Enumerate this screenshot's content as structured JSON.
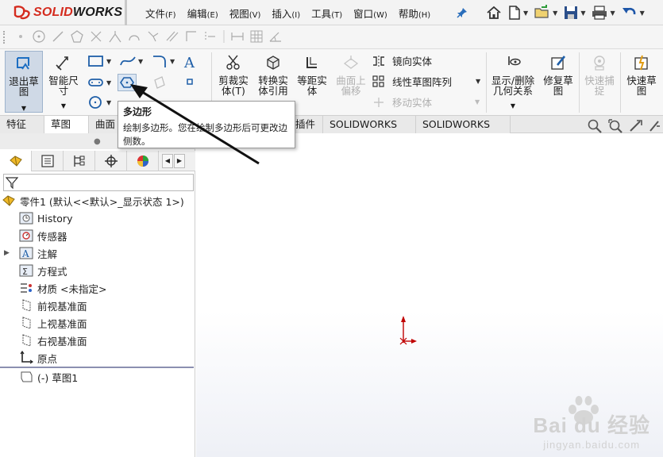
{
  "app": {
    "logo_prefix": "",
    "logo_accent": "SOLID",
    "logo_rest": "WORKS",
    "brand_color": "#d42b1e"
  },
  "menu": [
    {
      "label": "文件",
      "key": "(F)"
    },
    {
      "label": "编辑",
      "key": "(E)"
    },
    {
      "label": "视图",
      "key": "(V)"
    },
    {
      "label": "插入",
      "key": "(I)"
    },
    {
      "label": "工具",
      "key": "(T)"
    },
    {
      "label": "窗口",
      "key": "(W)"
    },
    {
      "label": "帮助",
      "key": "(H)"
    }
  ],
  "quick_access_icons": [
    "home-icon",
    "new-document-icon",
    "open-folder-icon",
    "save-icon",
    "print-icon",
    "undo-icon"
  ],
  "command_manager": {
    "exit_sketch": "退出草图",
    "smart_dimension": "智能尺寸",
    "trim_entities": "剪裁实体(T)",
    "convert_entities": "转换实体引用",
    "offset_entities": "等距实体",
    "surface_offset": "曲面上偏移",
    "mirror_entities": "镜向实体",
    "linear_pattern": "线性草图阵列",
    "move_entities": "移动实体",
    "display_delete_relations": "显示/删除几何关系",
    "repair_sketch": "修复草图",
    "quick_snaps": "快速捕捉",
    "rapid_sketch": "快速草图"
  },
  "tabs": [
    {
      "label": "特征",
      "active": false
    },
    {
      "label": "草图",
      "active": true
    },
    {
      "label": "曲面",
      "active": false
    },
    {
      "label": "插件",
      "active": false
    },
    {
      "label": "SOLIDWORKS MBD",
      "active": false
    },
    {
      "label": "SOLIDWORKS CAM",
      "active": false
    }
  ],
  "tooltip": {
    "title": "多边形",
    "body": "绘制多边形。您在绘制多边形后可更改边侧数。"
  },
  "feature_tree": {
    "root": "零件1  (默认<<默认>_显示状态 1>)",
    "items": [
      {
        "label": "History",
        "icon": "history-icon"
      },
      {
        "label": "传感器",
        "icon": "sensor-icon"
      },
      {
        "label": "注解",
        "icon": "annotation-icon"
      },
      {
        "label": "方程式",
        "icon": "equation-icon"
      },
      {
        "label": "材质 <未指定>",
        "icon": "material-icon"
      },
      {
        "label": "前视基准面",
        "icon": "plane-icon"
      },
      {
        "label": "上视基准面",
        "icon": "plane-icon"
      },
      {
        "label": "右视基准面",
        "icon": "plane-icon"
      },
      {
        "label": "原点",
        "icon": "origin-icon"
      },
      {
        "label": "(-) 草图1",
        "icon": "sketch-icon"
      }
    ]
  },
  "watermark": {
    "brand": "Bai du 经验",
    "url": "jingyan.baidu.com"
  }
}
